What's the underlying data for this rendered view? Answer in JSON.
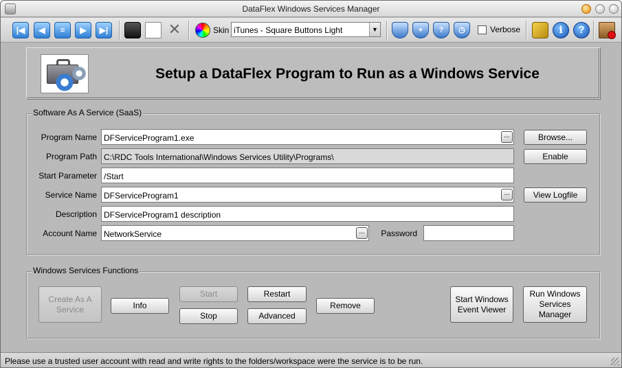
{
  "window": {
    "title": "DataFlex Windows Services Manager"
  },
  "toolbar": {
    "skin_label": "Skin",
    "skin_value": "iTunes - Square Buttons Light",
    "verbose_label": "Verbose",
    "verbose_checked": false
  },
  "banner": {
    "heading": "Setup a DataFlex Program to Run as a Windows Service"
  },
  "saas": {
    "group_label": "Software As A Service (SaaS)",
    "program_name_label": "Program Name",
    "program_name_value": "DFServiceProgram1.exe",
    "program_path_label": "Program Path",
    "program_path_value": "C:\\RDC Tools International\\Windows Services Utility\\Programs\\",
    "start_parameter_label": "Start Parameter",
    "start_parameter_value": "/Start",
    "service_name_label": "Service Name",
    "service_name_value": "DFServiceProgram1",
    "description_label": "Description",
    "description_value": "DFServiceProgram1 description",
    "account_name_label": "Account Name",
    "account_name_value": "NetworkService",
    "password_label": "Password",
    "password_value": "",
    "ellipsis": "...",
    "browse_label": "Browse...",
    "enable_label": "Enable",
    "view_logfile_label": "View Logfile"
  },
  "functions": {
    "group_label": "Windows Services Functions",
    "create_label": "Create As A Service",
    "info_label": "Info",
    "start_label": "Start",
    "stop_label": "Stop",
    "restart_label": "Restart",
    "advanced_label": "Advanced",
    "remove_label": "Remove",
    "event_viewer_label": "Start Windows Event Viewer",
    "services_manager_label": "Run Windows Services Manager"
  },
  "status": {
    "text": "Please use a trusted user account with read and write rights to the folders/workspace were the service is to be run."
  },
  "icons": {
    "nav": [
      "first-record-icon",
      "previous-record-icon",
      "clear-icon",
      "next-record-icon",
      "last-record-icon"
    ],
    "file": [
      "save-icon",
      "new-icon",
      "delete-icon"
    ],
    "shields": [
      "service-shield-icon",
      "add-service-shield-icon",
      "query-service-shield-icon",
      "service-schedule-shield-icon"
    ],
    "other": [
      "keys-icon",
      "info-icon",
      "help-icon",
      "exit-icon"
    ]
  }
}
